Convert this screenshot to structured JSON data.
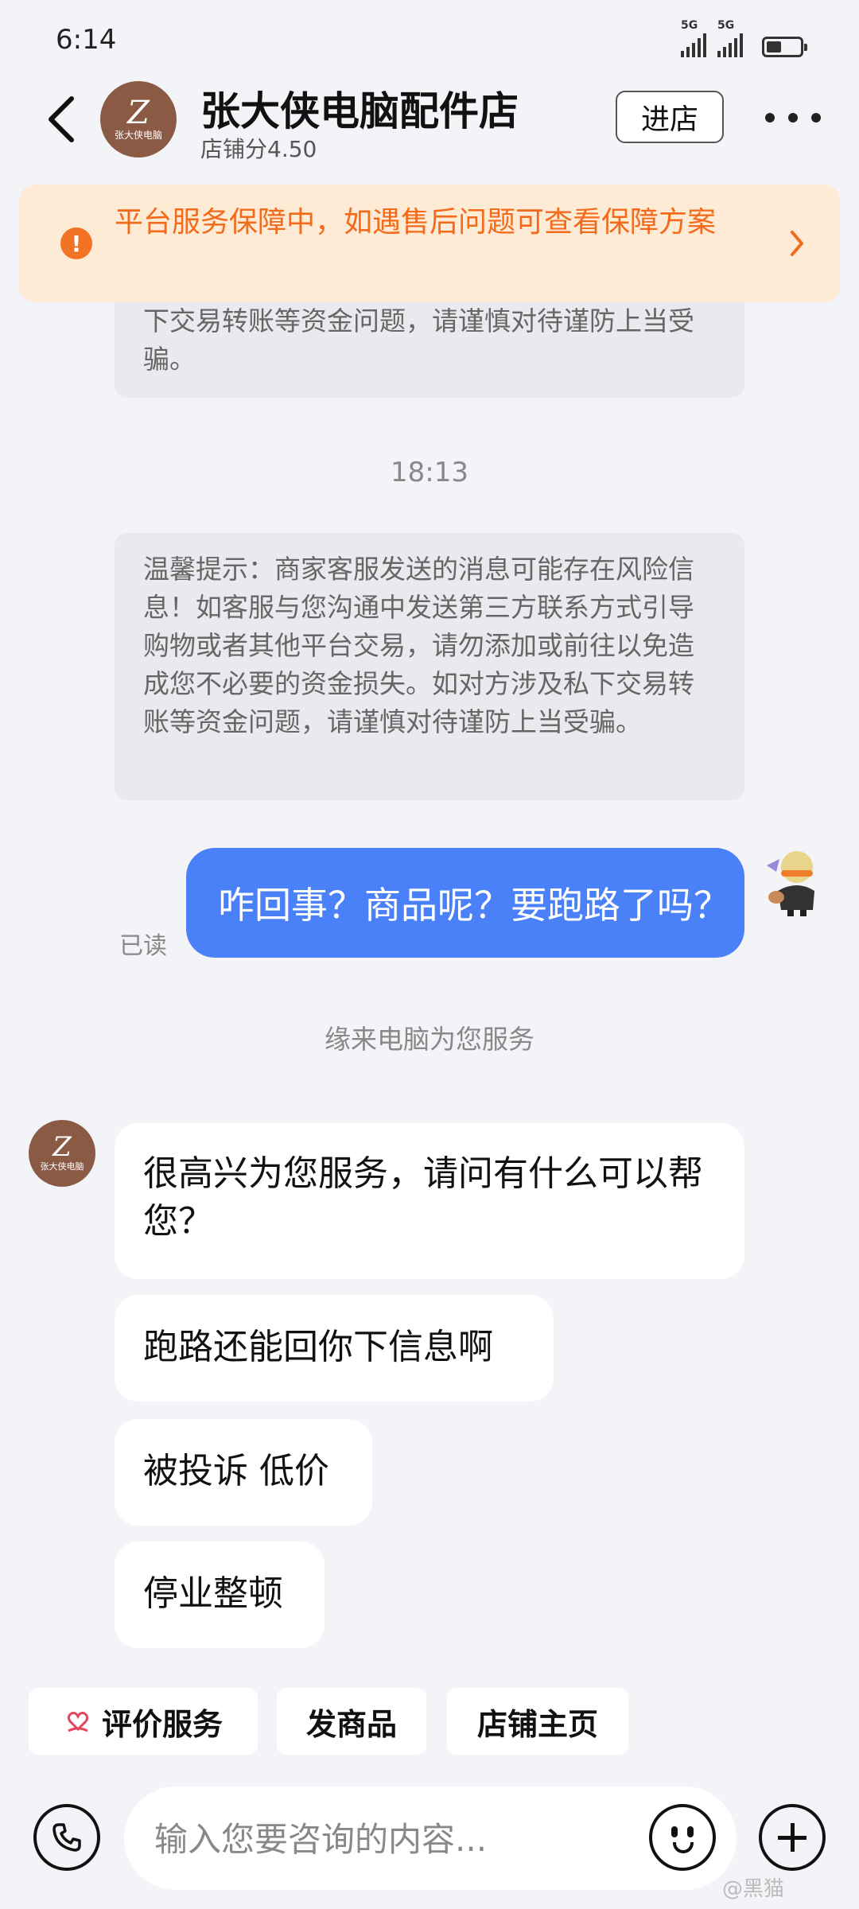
{
  "status": {
    "time": "6:14",
    "signal1": "5G",
    "signal2": "5G"
  },
  "header": {
    "shop_name": "张大侠电脑配件店",
    "shop_score": "店铺分4.50",
    "enter_label": "进店",
    "avatar_letter": "Z",
    "avatar_caption": "张大侠电脑"
  },
  "notice": {
    "text": "平台服务保障中，如遇售后问题可查看保障方案",
    "color": "#f36a1a"
  },
  "messages": {
    "tip_partial": "下交易转账等资金问题，请谨慎对待谨防上当受骗。",
    "timestamp": "18:13",
    "tip_full": "温馨提示：商家客服发送的消息可能存在风险信息！如客服与您沟通中发送第三方联系方式引导购物或者其他平台交易，请勿添加或前往以免造成您不必要的资金损失。如对方涉及私下交易转账等资金问题，请谨慎对待谨防上当受骗。",
    "my_message": "咋回事？商品呢？要跑路了吗？",
    "read_status": "已读",
    "service_note": "缘来电脑为您服务",
    "replies": [
      "很高兴为您服务，请问有什么可以帮您？",
      "跑路还能回你下信息啊",
      "被投诉 低价",
      "停业整顿"
    ]
  },
  "quick_actions": [
    "评价服务",
    "发商品",
    "店铺主页"
  ],
  "input": {
    "placeholder": "输入您要咨询的内容..."
  },
  "watermark": "@黑猫"
}
